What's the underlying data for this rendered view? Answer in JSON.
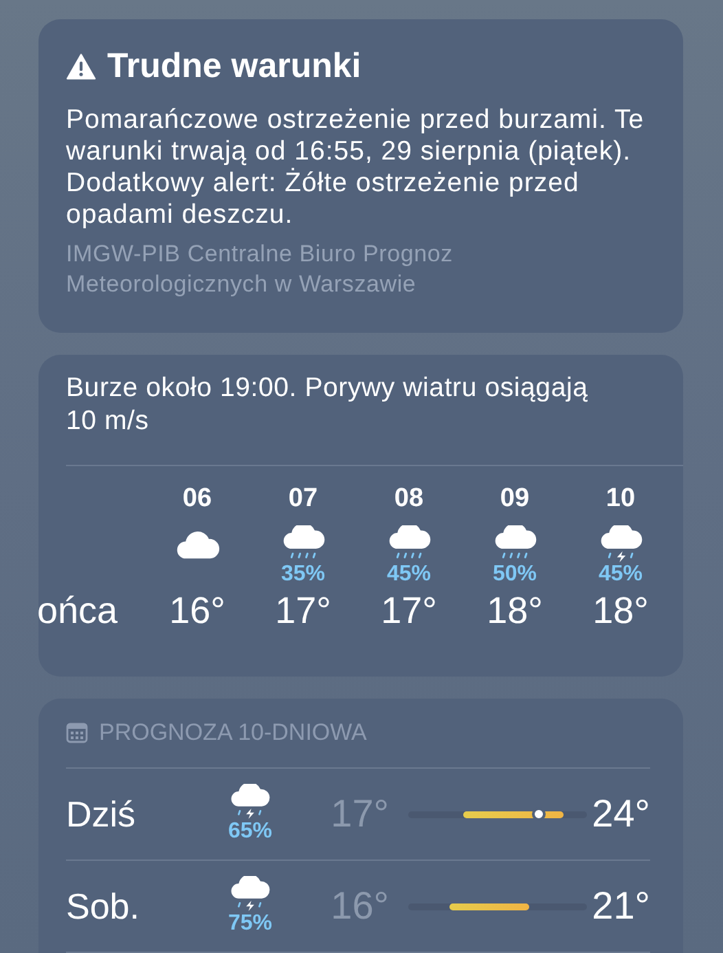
{
  "alert": {
    "title": "Trudne warunki",
    "text": "Pomarańczowe ostrzeżenie przed burzami. Te warunki trwają od 16:55, 29 sierpnia (piątek). Dodatkowy alert: Żółte ostrzeżenie przed opadami deszczu.",
    "source": "IMGW-PIB Centralne Biuro Prognoz Meteorologicznych w Warszawie"
  },
  "hourly": {
    "summary": "Burze około 19:00. Porywy wiatru osiągają 10 m/s",
    "hours": [
      {
        "kind": "partial",
        "temp": "ońca"
      },
      {
        "kind": "cloud",
        "time": "06",
        "temp": "16°"
      },
      {
        "kind": "rain",
        "time": "07",
        "chance": "35%",
        "temp": "17°"
      },
      {
        "kind": "rain",
        "time": "08",
        "chance": "45%",
        "temp": "17°"
      },
      {
        "kind": "rain",
        "time": "09",
        "chance": "50%",
        "temp": "18°"
      },
      {
        "kind": "storm",
        "time": "10",
        "chance": "45%",
        "temp": "18°"
      }
    ]
  },
  "daily": {
    "title": "PROGNOZA 10-DNIOWA",
    "days": [
      {
        "day": "Dziś",
        "kind": "storm",
        "chance": "65%",
        "low": "17°",
        "high": "24°",
        "current": {
          "level": 0.73
        }
      },
      {
        "day": "Sob.",
        "kind": "storm",
        "chance": "75%",
        "low": "16°",
        "high": "21°"
      }
    ]
  }
}
